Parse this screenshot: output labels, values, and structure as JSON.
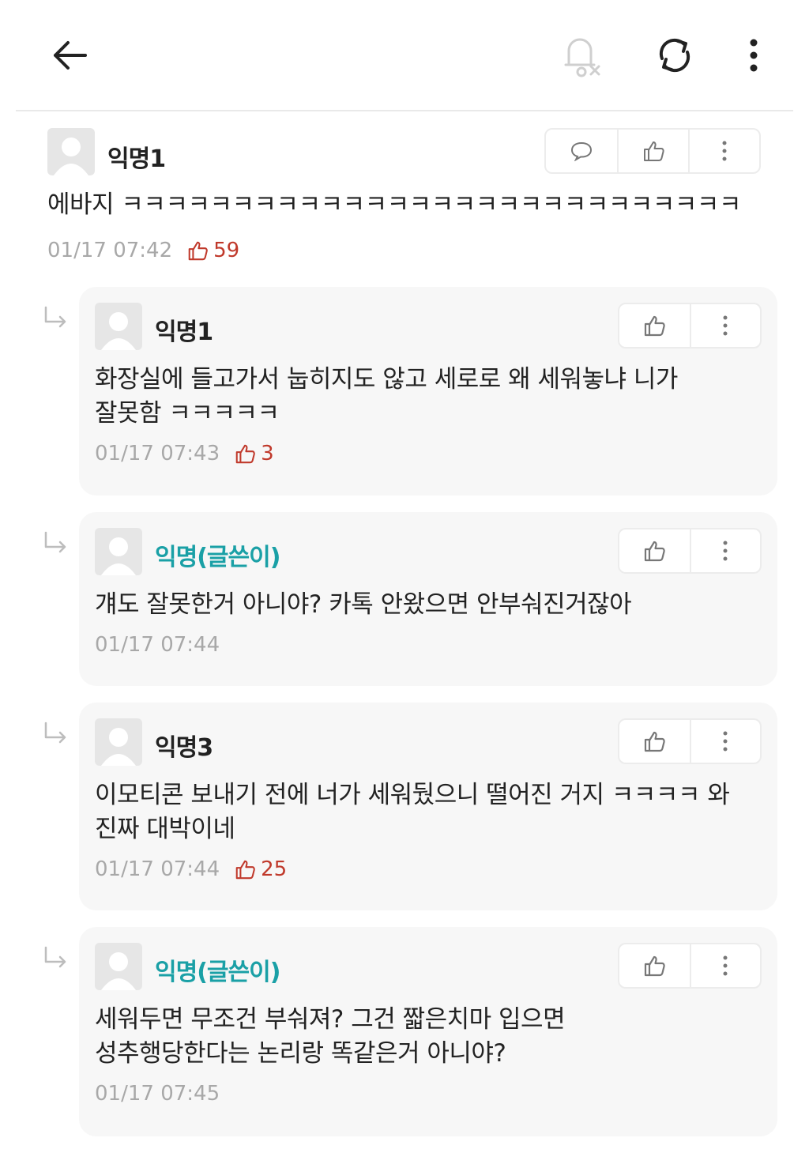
{
  "header": {
    "icons": [
      "back-arrow-icon",
      "notification-off-icon",
      "refresh-icon",
      "more-vertical-icon"
    ]
  },
  "comments": [
    {
      "author": "익명1",
      "text": "에바지 ㅋㅋㅋㅋㅋㅋㅋㅋㅋㅋㅋㅋㅋㅋㅋㅋㅋㅋㅋㅋㅋㅋㅋㅋㅋㅋㅋㅋ",
      "time": "01/17 07:42",
      "likes": "59"
    }
  ],
  "replies": [
    {
      "author": "익명1",
      "is_writer": false,
      "text_lines": [
        "화장실에 들고가서 눕히지도 않고 세로로 왜 세워놓냐 니가",
        "잘못함 ㅋㅋㅋㅋㅋ"
      ],
      "time": "01/17 07:43",
      "likes": "3"
    },
    {
      "author": "익명(글쓴이)",
      "is_writer": true,
      "text_lines": [
        "걔도 잘못한거 아니야? 카톡 안왔으면 안부숴진거잖아"
      ],
      "time": "01/17 07:44",
      "likes": ""
    },
    {
      "author": "익명3",
      "is_writer": false,
      "text_lines": [
        "이모티콘 보내기 전에 너가 세워뒀으니 떨어진 거지 ㅋㅋㅋㅋ 와",
        "진짜 대박이네"
      ],
      "time": "01/17 07:44",
      "likes": "25"
    },
    {
      "author": "익명(글쓴이)",
      "is_writer": true,
      "text_lines": [
        "세워두면 무조건 부숴져? 그건 짧은치마 입으면",
        "성추행당한다는 논리랑 똑같은거 아니야?"
      ],
      "time": "01/17 07:45",
      "likes": ""
    }
  ],
  "colors": {
    "writer_name": "#1aa0a6",
    "like_accent": "#c0392b",
    "meta_gray": "#a8a8a8",
    "reply_bg": "#f7f7f7"
  }
}
